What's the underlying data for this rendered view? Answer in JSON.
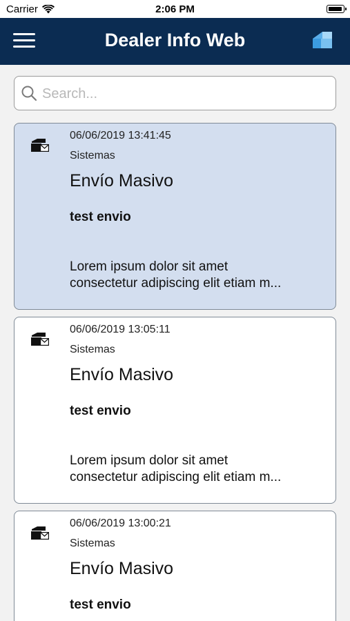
{
  "status_bar": {
    "carrier": "Carrier",
    "time": "2:06 PM"
  },
  "navbar": {
    "title": "Dealer Info Web",
    "background": "#0b2c52"
  },
  "search": {
    "placeholder": "Search..."
  },
  "messages": [
    {
      "date": "06/06/2019 13:41:45",
      "sender": "Sistemas",
      "title": "Envío Masivo",
      "subject": "test envio",
      "body_line1": "Lorem ipsum dolor sit amet",
      "body_line2": "consectetur adipiscing elit etiam m...",
      "selected": true
    },
    {
      "date": "06/06/2019 13:05:11",
      "sender": "Sistemas",
      "title": "Envío Masivo",
      "subject": "test envio",
      "body_line1": "Lorem ipsum dolor sit amet",
      "body_line2": "consectetur adipiscing elit etiam m...",
      "selected": false
    },
    {
      "date": "06/06/2019 13:00:21",
      "sender": "Sistemas",
      "title": "Envío Masivo",
      "subject": "test envio",
      "selected": false
    }
  ],
  "icons": {
    "menu": "hamburger-menu-icon",
    "brand": "dealer-logo-icon",
    "search": "search-icon",
    "message": "mail-box-icon",
    "wifi": "wifi-icon",
    "battery": "battery-icon"
  },
  "colors": {
    "selected_card": "#d3deef",
    "brand_blue": "#3b9be0"
  }
}
